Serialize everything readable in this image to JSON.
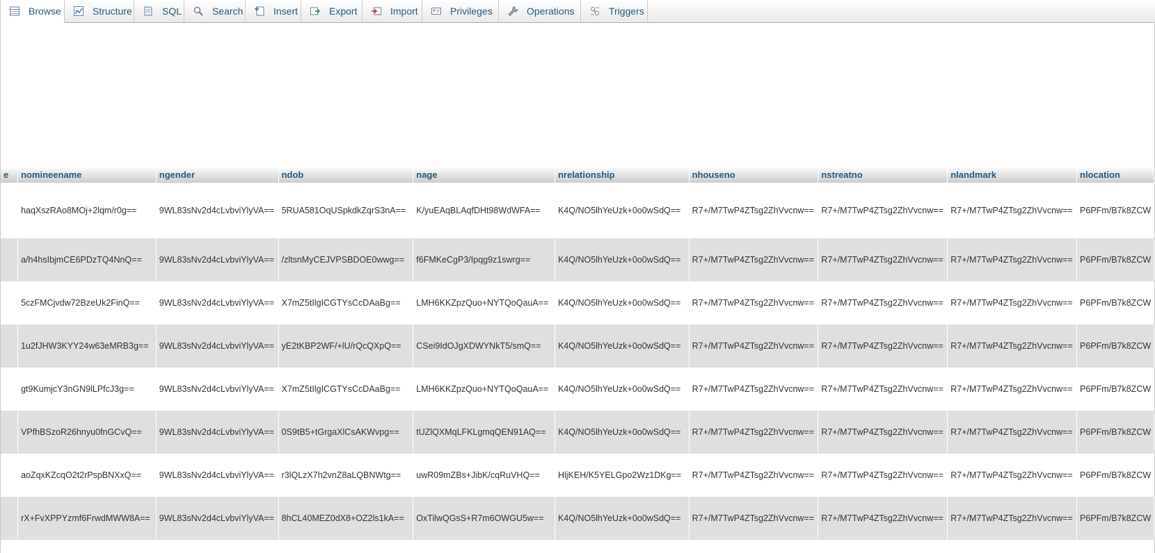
{
  "tabs": [
    {
      "label": "Browse",
      "icon": "browse-icon",
      "active": true
    },
    {
      "label": "Structure",
      "icon": "structure-icon",
      "active": false
    },
    {
      "label": "SQL",
      "icon": "sql-icon",
      "active": false
    },
    {
      "label": "Search",
      "icon": "search-icon",
      "active": false
    },
    {
      "label": "Insert",
      "icon": "insert-icon",
      "active": false
    },
    {
      "label": "Export",
      "icon": "export-icon",
      "active": false
    },
    {
      "label": "Import",
      "icon": "import-icon",
      "active": false
    },
    {
      "label": "Privileges",
      "icon": "privileges-icon",
      "active": false
    },
    {
      "label": "Operations",
      "icon": "operations-icon",
      "active": false
    },
    {
      "label": "Triggers",
      "icon": "triggers-icon",
      "active": false
    }
  ],
  "table": {
    "columns": [
      "e",
      "nomineename",
      "ngender",
      "ndob",
      "nage",
      "nrelationship",
      "nhouseno",
      "nstreatno",
      "nlandmark",
      "nlocation"
    ],
    "rows": [
      [
        "",
        "haqXszRAo8MOj+2lqm/r0g==",
        "9WL83sNv2d4cLvbviYlyVA==",
        "5RUA581OqUSpkdkZqrS3nA==",
        "K/yuEAqBLAqfDHt98WdWFA==",
        "K4Q/NO5lhYeUzk+0o0wSdQ==",
        "R7+/M7TwP4ZTsg2ZhVvcnw==",
        "R7+/M7TwP4ZTsg2ZhVvcnw==",
        "R7+/M7TwP4ZTsg2ZhVvcnw==",
        "P6PFm/B7k8ZCW"
      ],
      [
        "",
        "a/h4hsIbjmCE6PDzTQ4NnQ==",
        "9WL83sNv2d4cLvbviYlyVA==",
        "/zltsnMyCEJVPSBDOE0wwg==",
        "f6FMKeCgP3/Ipqg9z1swrg==",
        "K4Q/NO5lhYeUzk+0o0wSdQ==",
        "R7+/M7TwP4ZTsg2ZhVvcnw==",
        "R7+/M7TwP4ZTsg2ZhVvcnw==",
        "R7+/M7TwP4ZTsg2ZhVvcnw==",
        "P6PFm/B7k8ZCW"
      ],
      [
        "",
        "5czFMCjvdw72BzeUk2FinQ==",
        "9WL83sNv2d4cLvbviYlyVA==",
        "X7mZ5tIlgICGTYsCcDAaBg==",
        "LMH6KKZpzQuo+NYTQoQauA==",
        "K4Q/NO5lhYeUzk+0o0wSdQ==",
        "R7+/M7TwP4ZTsg2ZhVvcnw==",
        "R7+/M7TwP4ZTsg2ZhVvcnw==",
        "R7+/M7TwP4ZTsg2ZhVvcnw==",
        "P6PFm/B7k8ZCW"
      ],
      [
        "",
        "1u2fJHW3KYY24w63eMRB3g==",
        "9WL83sNv2d4cLvbviYlyVA==",
        "yE2tKBP2WF/+lU/rQcQXpQ==",
        "CSei9IdOJgXDWYNkT5/smQ==",
        "K4Q/NO5lhYeUzk+0o0wSdQ==",
        "R7+/M7TwP4ZTsg2ZhVvcnw==",
        "R7+/M7TwP4ZTsg2ZhVvcnw==",
        "R7+/M7TwP4ZTsg2ZhVvcnw==",
        "P6PFm/B7k8ZCW"
      ],
      [
        "",
        "gt9KumjcY3nGN9lLPfcJ3g==",
        "9WL83sNv2d4cLvbviYlyVA==",
        "X7mZ5tIlgICGTYsCcDAaBg==",
        "LMH6KKZpzQuo+NYTQoQauA==",
        "K4Q/NO5lhYeUzk+0o0wSdQ==",
        "R7+/M7TwP4ZTsg2ZhVvcnw==",
        "R7+/M7TwP4ZTsg2ZhVvcnw==",
        "R7+/M7TwP4ZTsg2ZhVvcnw==",
        "P6PFm/B7k8ZCW"
      ],
      [
        "",
        "VPfhBSzoR26hnyu0fnGCvQ==",
        "9WL83sNv2d4cLvbviYlyVA==",
        "0S9tB5+tGrgaXlCsAKWvpg==",
        "tUZlQXMqLFKLgmqQEN91AQ==",
        "K4Q/NO5lhYeUzk+0o0wSdQ==",
        "R7+/M7TwP4ZTsg2ZhVvcnw==",
        "R7+/M7TwP4ZTsg2ZhVvcnw==",
        "R7+/M7TwP4ZTsg2ZhVvcnw==",
        "P6PFm/B7k8ZCW"
      ],
      [
        "",
        "aoZqxKZcqO2t2rPspBNXxQ==",
        "9WL83sNv2d4cLvbviYlyVA==",
        "r3lQLzX7h2vnZ8aLQBNWtg==",
        "uwR09mZBs+JibK/cqRuVHQ==",
        "HljKEH/K5YELGpo2Wz1DKg==",
        "R7+/M7TwP4ZTsg2ZhVvcnw==",
        "R7+/M7TwP4ZTsg2ZhVvcnw==",
        "R7+/M7TwP4ZTsg2ZhVvcnw==",
        "P6PFm/B7k8ZCW"
      ],
      [
        "",
        "rX+FvXPPYzmf6FrwdMWW8A==",
        "9WL83sNv2d4cLvbviYlyVA==",
        "8hCL40MEZ0dX8+OZ2ls1kA==",
        "OxTilwQGsS+R7m6OWGU5w==",
        "K4Q/NO5lhYeUzk+0o0wSdQ==",
        "R7+/M7TwP4ZTsg2ZhVvcnw==",
        "R7+/M7TwP4ZTsg2ZhVvcnw==",
        "R7+/M7TwP4ZTsg2ZhVvcnw==",
        "P6PFm/B7k8ZCW"
      ]
    ]
  },
  "colors": {
    "link": "#235a81",
    "row_alt": "#dfdfdf",
    "text": "#333333"
  }
}
